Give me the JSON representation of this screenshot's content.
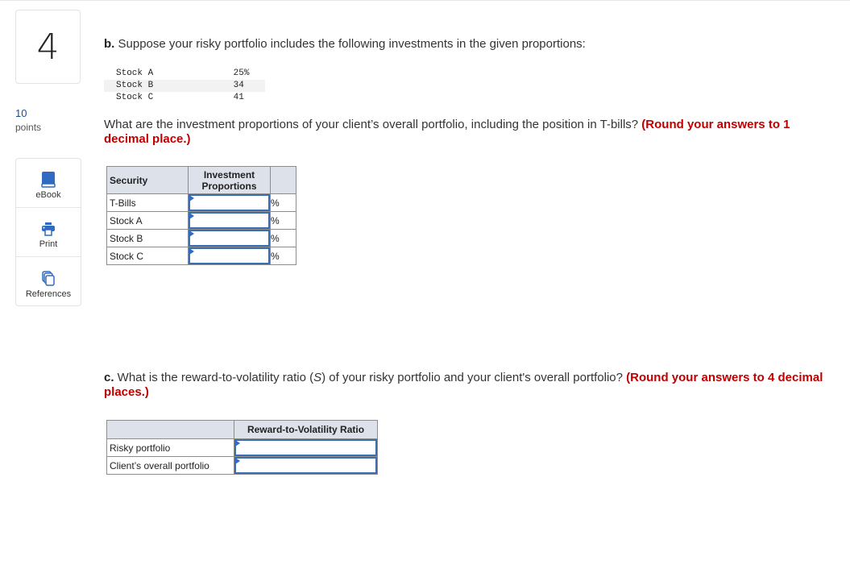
{
  "question": {
    "number": "4",
    "points_value": "10",
    "points_label": "points"
  },
  "tools": [
    {
      "label": "eBook",
      "icon": "book-icon"
    },
    {
      "label": "Print",
      "icon": "printer-icon"
    },
    {
      "label": "References",
      "icon": "documents-icon"
    }
  ],
  "part_b": {
    "prefix": "b.",
    "prompt": " Suppose your risky portfolio includes the following investments in the given proportions:",
    "given": [
      {
        "name": "Stock A",
        "value": "25%"
      },
      {
        "name": "Stock B",
        "value": "34"
      },
      {
        "name": "Stock C",
        "value": "41"
      }
    ],
    "question": "What are the investment proportions of your client’s overall portfolio, including the position in T-bills? ",
    "instruction": "(Round your answers to 1 decimal place.)",
    "table": {
      "headers": [
        "Security",
        "Investment Proportions",
        ""
      ],
      "rows": [
        {
          "label": "T-Bills",
          "value": "",
          "unit": "%"
        },
        {
          "label": "Stock A",
          "value": "",
          "unit": "%"
        },
        {
          "label": "Stock B",
          "value": "",
          "unit": "%"
        },
        {
          "label": "Stock C",
          "value": "",
          "unit": "%"
        }
      ]
    }
  },
  "part_c": {
    "prefix": "c.",
    "prompt_before": " What is the reward-to-volatility ratio (",
    "symbol": "S",
    "prompt_after": ") of your risky portfolio and your client's overall portfolio? ",
    "instruction": "(Round your answers to 4 decimal places.)",
    "table": {
      "headers": [
        "",
        "Reward-to-Volatility Ratio"
      ],
      "rows": [
        {
          "label": "Risky portfolio",
          "value": ""
        },
        {
          "label": "Client’s overall portfolio",
          "value": ""
        }
      ]
    }
  }
}
